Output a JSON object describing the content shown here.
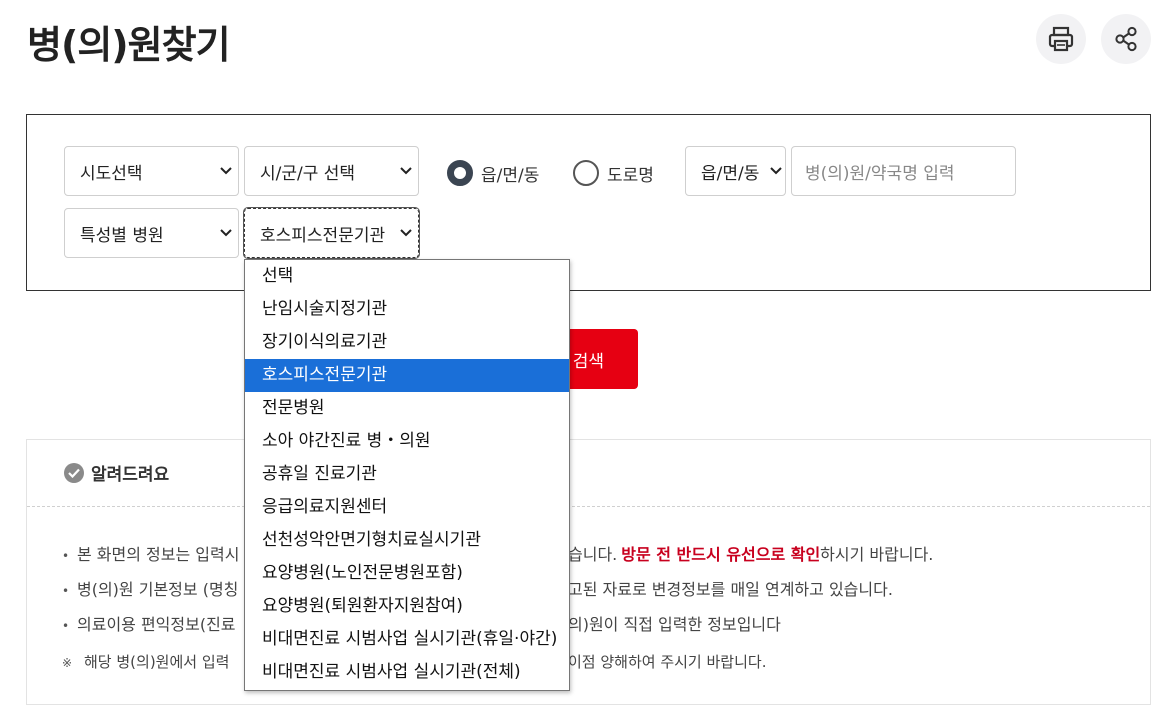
{
  "page": {
    "title": "병(의)원찾기"
  },
  "toolbar": {
    "print_icon": "printer-icon",
    "share_icon": "share-icon"
  },
  "search": {
    "sido_select": "시도선택",
    "sigungu_select": "시/군/구 선택",
    "radio_eupmyeon": "읍/면/동",
    "radio_road": "도로명",
    "radio_selected": "읍/면/동",
    "eupmyeon_select": "읍/면/동",
    "name_placeholder": "병(의)원/약국명 입력",
    "specialty_select": "특성별 병원",
    "institution_select": "호스피스전문기관",
    "search_button": "검색"
  },
  "dropdown": {
    "options": [
      "선택",
      "난임시술지정기관",
      "장기이식의료기관",
      "호스피스전문기관",
      "전문병원",
      "소아 야간진료 병・의원",
      "공휴일 진료기관",
      "응급의료지원센터",
      "선천성악안면기형치료실시기관",
      "요양병원(노인전문병원포함)",
      "요양병원(퇴원환자지원참여)",
      "비대면진료 시범사업 실시기관(휴일·야간)",
      "비대면진료 시범사업 실시기관(전체)"
    ],
    "selected": "호스피스전문기관"
  },
  "notice": {
    "title": "알려드려요",
    "line1_a": "본 화면의 정보는 입력시",
    "line1_b": "습니다.",
    "line1_red": "방문 전 반드시 유선으로 확인",
    "line1_c": "하시기 바랍니다.",
    "line2_a": "병(의)원 기본정보 (명칭",
    "line2_b": "고된 자료로 변경정보를 매일 연계하고 있습니다.",
    "line3_a": "의료이용 편익정보(진료",
    "line3_b": "의)원이 직접 입력한 정보입니다",
    "line4_mark": "※",
    "line4_a": "해당 병(의)원에서 입력",
    "line4_b": "이점 양해하여 주시기 바랍니다."
  },
  "colors": {
    "search_button": "#e60012",
    "selected_option": "#1a6fd8",
    "notice_emphasis": "#c8001e"
  }
}
